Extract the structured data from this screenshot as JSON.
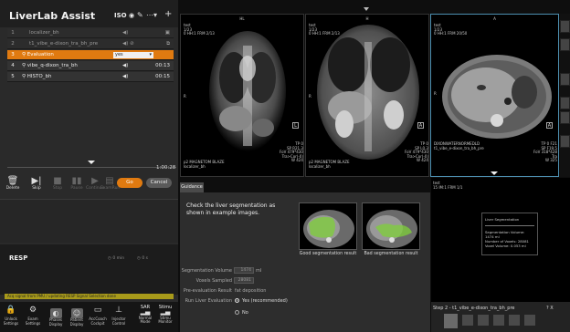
{
  "app": {
    "title": "LiverLab Assist",
    "header_mode": "ISO",
    "header_icons": [
      "eye-icon",
      "pencil-icon",
      "more-icon",
      "add-icon"
    ]
  },
  "program": {
    "rows": [
      {
        "num": "1",
        "name": "localizer_bh",
        "icon": "speaker-icon"
      },
      {
        "num": "2",
        "name": "t1_vibe_e-dixon_tra_bh_pre",
        "icon": "speaker-icon"
      },
      {
        "num": "3",
        "name": "Evaluation",
        "select_value": "yes"
      },
      {
        "num": "4",
        "name": "vibe_q-dixon_tra_bh",
        "icon": "speaker-icon",
        "time": "00:13"
      },
      {
        "num": "5",
        "name": "HISTO_bh",
        "icon": "speaker-icon",
        "time": "00:15"
      }
    ],
    "total_time": "1:00:28"
  },
  "controls": {
    "delete": "Delete",
    "skip": "Skip",
    "stop": "Stop",
    "pause": "Pause",
    "continue": "Continue",
    "exam_run": "ExamRun",
    "go": "Go",
    "cancel": "Cancel"
  },
  "resp": {
    "label": "RESP",
    "stat1": "0 min",
    "stat2": "0 s"
  },
  "status_bar": "Acq signal from PMU / updating RESP Signal Selection done",
  "footer": [
    {
      "label": "Unlock Settings",
      "icon": "lock-icon"
    },
    {
      "label": "Exam Settings",
      "icon": "gear-icon"
    },
    {
      "label": "Phases Display",
      "icon": "phases-icon"
    },
    {
      "label": "Patient Display",
      "icon": "patient-icon"
    },
    {
      "label": "AccCoach Cockpit",
      "icon": "cockpit-icon"
    },
    {
      "label": "Injector Control",
      "icon": "injector-icon"
    },
    {
      "label": "Normal Mode",
      "icon": "sar-icon",
      "top": "SAR"
    },
    {
      "label": "Stimu Monitor",
      "icon": "stim-icon",
      "top": "Stimu"
    }
  ],
  "viewers": [
    {
      "orient_top": "HL",
      "orient_side": "R",
      "info": [
        "test",
        "1/23",
        "0 HH:1 FRM 2/13"
      ],
      "bottom": [
        "p2 MAGNETOM BLAZE",
        "localizer_bh"
      ],
      "right_info": [
        "TP 0",
        "SP R21.3",
        "FoV 479*430",
        "Tra>Cor(-0)",
        "W 424"
      ]
    },
    {
      "orient_top": "H",
      "orient_side": "R",
      "info": [
        "test",
        "1/23",
        "0 HH:1 FRM 2/13"
      ],
      "bottom": [
        "p2 MAGNETOM BLAZE",
        "localizer_bh"
      ],
      "right_info": [
        "TP 0",
        "SP L0.3",
        "FoV 479*430",
        "Tra>Cor(-0)",
        "W 424"
      ]
    },
    {
      "orient_top": "A",
      "orient_side": "R",
      "info": [
        "test",
        "1/23",
        "0 HH:1 FRM 20/50"
      ],
      "bottom": [
        "DIXONWATERNORMEDLD",
        "t1_vibe_e-dixon_tra_bh_pre"
      ],
      "right_info": [
        "TP 0 F21",
        "SP F19.5",
        "FoV 318*428",
        "Tra",
        "W 325"
      ]
    }
  ],
  "guidance": {
    "tab": "Guidance",
    "instruction": "Check the liver segmentation as shown in example images.",
    "volume_label": "Segmentation Volume",
    "volume_value": "1474",
    "volume_unit": "ml",
    "voxels_label": "Voxels Sampled",
    "voxels_value": "28081",
    "preeval_label": "Pre-evaluation Result",
    "preeval_value": "fat deposition",
    "run_label": "Run Liver Evaluation",
    "opt_yes": "Yes (recommended)",
    "opt_no": "No",
    "good_caption": "Good segmentation result",
    "bad_caption": "Bad segmentation result"
  },
  "right_info": {
    "lines": [
      "test",
      "15 IM:1 FRM 1/1"
    ],
    "box": [
      "Liver Segmentation",
      "Segmentation Volume: 1474 ml",
      "Number of Voxels: 28081",
      "Voxel Volume: 0.053 ml"
    ],
    "step": "Step 2 - t1_vibe_e-dixon_tra_bh_pre",
    "help": "? X"
  }
}
